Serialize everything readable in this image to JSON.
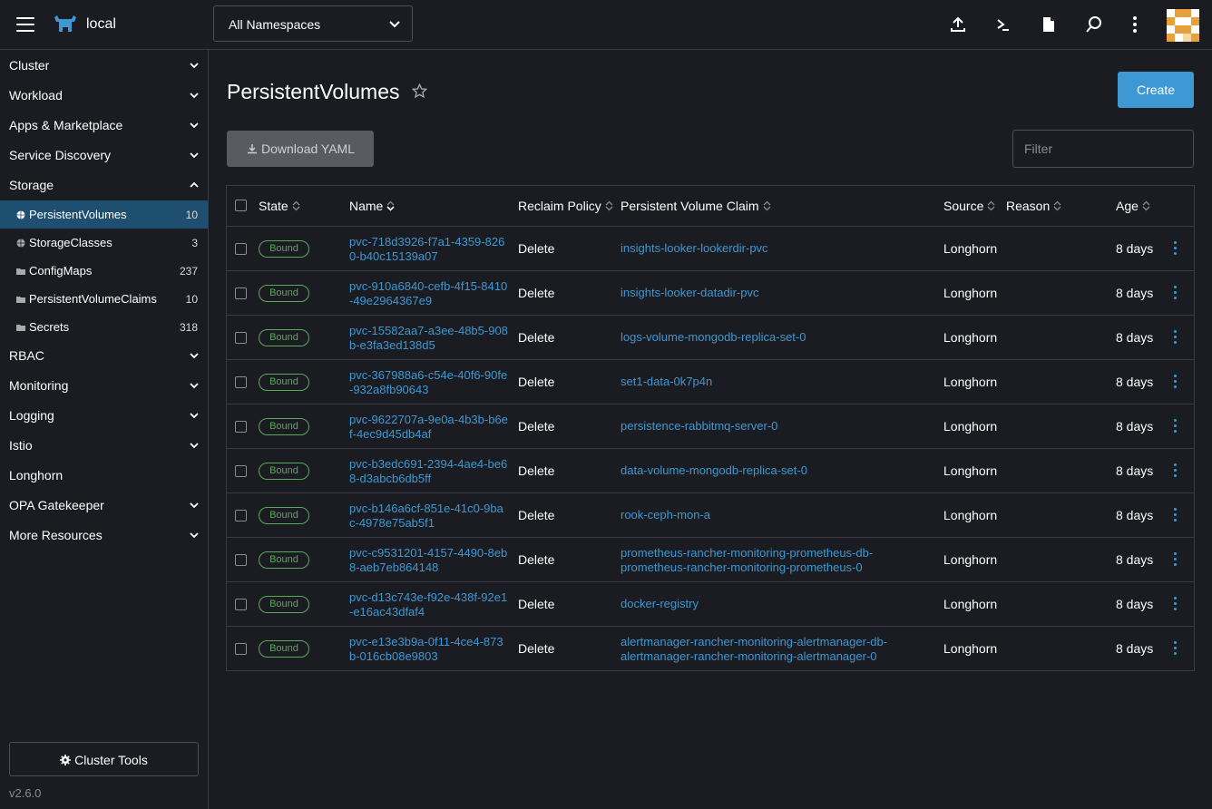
{
  "header": {
    "cluster_name": "local",
    "namespace_select": "All Namespaces",
    "icons": [
      "upload-icon",
      "shell-icon",
      "file-icon",
      "search-icon",
      "more-vertical-icon"
    ]
  },
  "sidebar": {
    "groups_top": [
      {
        "label": "Cluster"
      },
      {
        "label": "Workload"
      },
      {
        "label": "Apps & Marketplace"
      },
      {
        "label": "Service Discovery"
      },
      {
        "label": "Storage"
      }
    ],
    "storage_items": [
      {
        "label": "PersistentVolumes",
        "count": "10",
        "icon": "globe-icon"
      },
      {
        "label": "StorageClasses",
        "count": "3",
        "icon": "globe-icon"
      },
      {
        "label": "ConfigMaps",
        "count": "237",
        "icon": "folder-icon"
      },
      {
        "label": "PersistentVolumeClaims",
        "count": "10",
        "icon": "folder-icon"
      },
      {
        "label": "Secrets",
        "count": "318",
        "icon": "folder-icon"
      }
    ],
    "groups_bottom": [
      {
        "label": "RBAC"
      },
      {
        "label": "Monitoring"
      },
      {
        "label": "Logging"
      },
      {
        "label": "Istio"
      },
      {
        "label": "Longhorn"
      },
      {
        "label": "OPA Gatekeeper"
      },
      {
        "label": "More Resources"
      }
    ],
    "cluster_tools": "Cluster Tools",
    "version": "v2.6.0"
  },
  "main": {
    "title": "PersistentVolumes",
    "create_label": "Create",
    "download_label": "Download YAML",
    "filter_placeholder": "Filter",
    "columns": {
      "state": "State",
      "name": "Name",
      "reclaim": "Reclaim Policy",
      "pvc": "Persistent Volume Claim",
      "source": "Source",
      "reason": "Reason",
      "age": "Age"
    },
    "rows": [
      {
        "state": "Bound",
        "name": "pvc-718d3926-f7a1-4359-8260-b40c15139a07",
        "reclaim": "Delete",
        "pvc": "insights-looker-lookerdir-pvc",
        "source": "Longhorn",
        "age": "8 days"
      },
      {
        "state": "Bound",
        "name": "pvc-910a6840-cefb-4f15-8410-49e2964367e9",
        "reclaim": "Delete",
        "pvc": "insights-looker-datadir-pvc",
        "source": "Longhorn",
        "age": "8 days"
      },
      {
        "state": "Bound",
        "name": "pvc-15582aa7-a3ee-48b5-908b-e3fa3ed138d5",
        "reclaim": "Delete",
        "pvc": "logs-volume-mongodb-replica-set-0",
        "source": "Longhorn",
        "age": "8 days"
      },
      {
        "state": "Bound",
        "name": "pvc-367988a6-c54e-40f6-90fe-932a8fb90643",
        "reclaim": "Delete",
        "pvc": "set1-data-0k7p4n",
        "source": "Longhorn",
        "age": "8 days"
      },
      {
        "state": "Bound",
        "name": "pvc-9622707a-9e0a-4b3b-b6ef-4ec9d45db4af",
        "reclaim": "Delete",
        "pvc": "persistence-rabbitmq-server-0",
        "source": "Longhorn",
        "age": "8 days"
      },
      {
        "state": "Bound",
        "name": "pvc-b3edc691-2394-4ae4-be68-d3abcb6db5ff",
        "reclaim": "Delete",
        "pvc": "data-volume-mongodb-replica-set-0",
        "source": "Longhorn",
        "age": "8 days"
      },
      {
        "state": "Bound",
        "name": "pvc-b146a6cf-851e-41c0-9bac-4978e75ab5f1",
        "reclaim": "Delete",
        "pvc": "rook-ceph-mon-a",
        "source": "Longhorn",
        "age": "8 days"
      },
      {
        "state": "Bound",
        "name": "pvc-c9531201-4157-4490-8eb8-aeb7eb864148",
        "reclaim": "Delete",
        "pvc": "prometheus-rancher-monitoring-prometheus-db-prometheus-rancher-monitoring-prometheus-0",
        "source": "Longhorn",
        "age": "8 days"
      },
      {
        "state": "Bound",
        "name": "pvc-d13c743e-f92e-438f-92e1-e16ac43dfaf4",
        "reclaim": "Delete",
        "pvc": "docker-registry",
        "source": "Longhorn",
        "age": "8 days"
      },
      {
        "state": "Bound",
        "name": "pvc-e13e3b9a-0f11-4ce4-873b-016cb08e9803",
        "reclaim": "Delete",
        "pvc": "alertmanager-rancher-monitoring-alertmanager-db-alertmanager-rancher-monitoring-alertmanager-0",
        "source": "Longhorn",
        "age": "8 days"
      }
    ]
  },
  "colors": {
    "background": "#1b1c21",
    "accent": "#3d98d3",
    "active_nav": "#1e4e70",
    "bound": "#5aa85c",
    "border": "#3a3b42"
  }
}
